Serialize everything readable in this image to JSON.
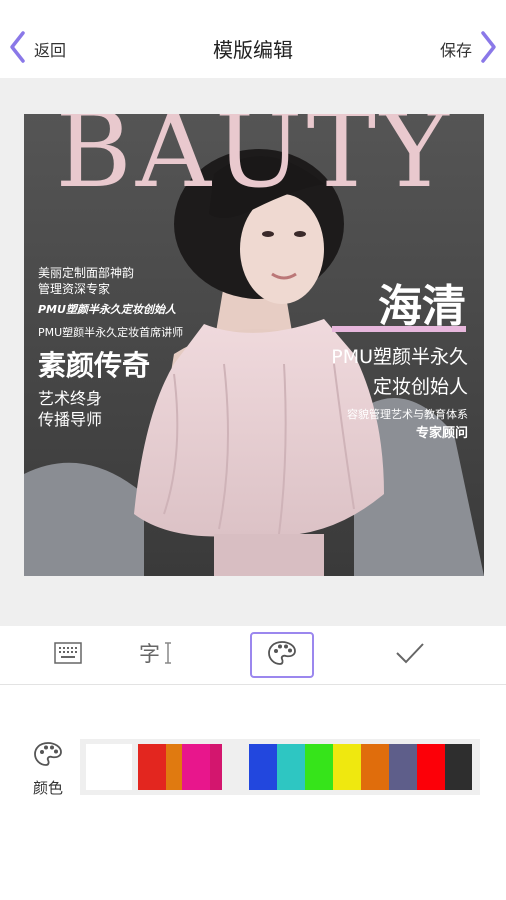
{
  "nav": {
    "back_label": "返回",
    "title": "模版编辑",
    "save_label": "保存"
  },
  "poster": {
    "masthead": "BAUTY",
    "left": {
      "line1": "美丽定制面部神韵",
      "line2": "管理资深专家",
      "line3": "PMU塑颜半永久定妆创始人",
      "line4": "PMU塑颜半永久定妆首席讲师",
      "headline": "素颜传奇",
      "sub1": "艺术终身",
      "sub2": "传播导师"
    },
    "right": {
      "name": "海清",
      "line1": "PMU塑颜半永久",
      "line2": "定妆创始人",
      "line3": "容貌管理艺术与教育体系",
      "line4": "专家顾问"
    }
  },
  "toolbar": {
    "tools": [
      "keyboard-icon",
      "text-style-icon",
      "palette-icon",
      "checkmark-icon"
    ],
    "active": "palette-icon"
  },
  "color_panel": {
    "label": "颜色",
    "swatches": [
      "#ffffff",
      "#e3261f",
      "#e07a10",
      "#e8168c",
      "#d3166e",
      "#2247de",
      "#2ec6c2",
      "#36e41a",
      "#efe80f",
      "#e06d0c",
      "#5e5e8a",
      "#fc0008",
      "#2e2e2e"
    ]
  }
}
